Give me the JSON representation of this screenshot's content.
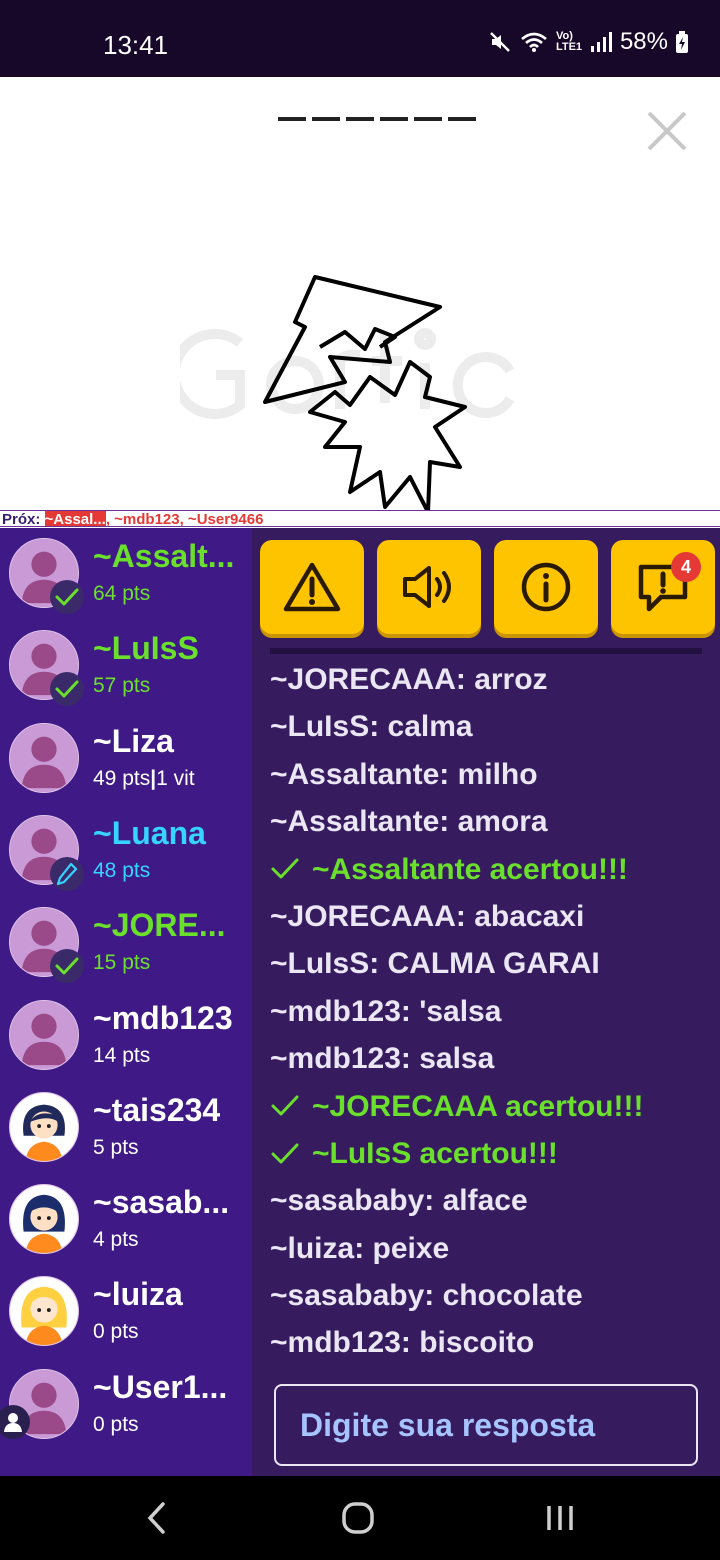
{
  "status_bar": {
    "time": "13:41",
    "battery": "58%",
    "net_label": "Vo) LTE1"
  },
  "header": {
    "blank_count": 6
  },
  "next_players": {
    "label": "Próx:",
    "first": "~Assal...",
    "others": ", ~mdb123, ~User9466"
  },
  "players": [
    {
      "name": "~Assalt...",
      "points": "64 pts",
      "status": "guessed",
      "color": "green",
      "avatar": "default"
    },
    {
      "name": "~LuIsS",
      "points": "57 pts",
      "status": "guessed",
      "color": "green",
      "avatar": "default"
    },
    {
      "name": "~Liza",
      "points": "49 pts",
      "wins": "1 vit",
      "status": "none",
      "color": "white",
      "avatar": "default"
    },
    {
      "name": "~Luana",
      "points": "48 pts",
      "status": "drawing",
      "color": "cyan",
      "avatar": "default"
    },
    {
      "name": "~JORE...",
      "points": "15 pts",
      "status": "guessed",
      "color": "green",
      "avatar": "default"
    },
    {
      "name": "~mdb123",
      "points": "14 pts",
      "status": "none",
      "color": "white",
      "avatar": "default"
    },
    {
      "name": "~tais234",
      "points": "5 pts",
      "status": "none",
      "color": "white",
      "avatar": "girl-black-hair"
    },
    {
      "name": "~sasab...",
      "points": "4 pts",
      "status": "none",
      "color": "white",
      "avatar": "girl-navy-hair"
    },
    {
      "name": "~luiza",
      "points": "0 pts",
      "status": "none",
      "color": "white",
      "avatar": "girl-blonde-hair"
    },
    {
      "name": "~User1...",
      "points": "0 pts",
      "status": "guest",
      "color": "white",
      "avatar": "default"
    }
  ],
  "toolbar": {
    "buttons": [
      "report-icon",
      "sound-icon",
      "info-icon",
      "chat-icon"
    ],
    "chat_badge": "4"
  },
  "chat": {
    "messages": [
      {
        "text": "~JORECAAA: arroz",
        "type": "normal"
      },
      {
        "text": "~LuIsS: calma",
        "type": "normal"
      },
      {
        "text": "~Assaltante: milho",
        "type": "normal"
      },
      {
        "text": "~Assaltante: amora",
        "type": "normal"
      },
      {
        "text": "~Assaltante acertou!!!",
        "type": "correct"
      },
      {
        "text": "~JORECAAA: abacaxi",
        "type": "normal"
      },
      {
        "text": "~LuIsS: CALMA GARAI",
        "type": "normal"
      },
      {
        "text": "~mdb123: 'salsa",
        "type": "normal"
      },
      {
        "text": "~mdb123: salsa",
        "type": "normal"
      },
      {
        "text": "~JORECAAA acertou!!!",
        "type": "correct"
      },
      {
        "text": "~LuIsS acertou!!!",
        "type": "correct"
      },
      {
        "text": "~sasababy: alface",
        "type": "normal"
      },
      {
        "text": "~luiza: peixe",
        "type": "normal"
      },
      {
        "text": "~sasababy: chocolate",
        "type": "normal"
      },
      {
        "text": "~mdb123: biscoito",
        "type": "normal"
      }
    ],
    "input_placeholder": "Digite sua resposta"
  },
  "colors": {
    "players_bg": "#3f1a86",
    "chat_bg": "#361c5e",
    "accent_yellow": "#ffc400",
    "correct_green": "#6be02c",
    "drawer_cyan": "#35d5ff"
  }
}
